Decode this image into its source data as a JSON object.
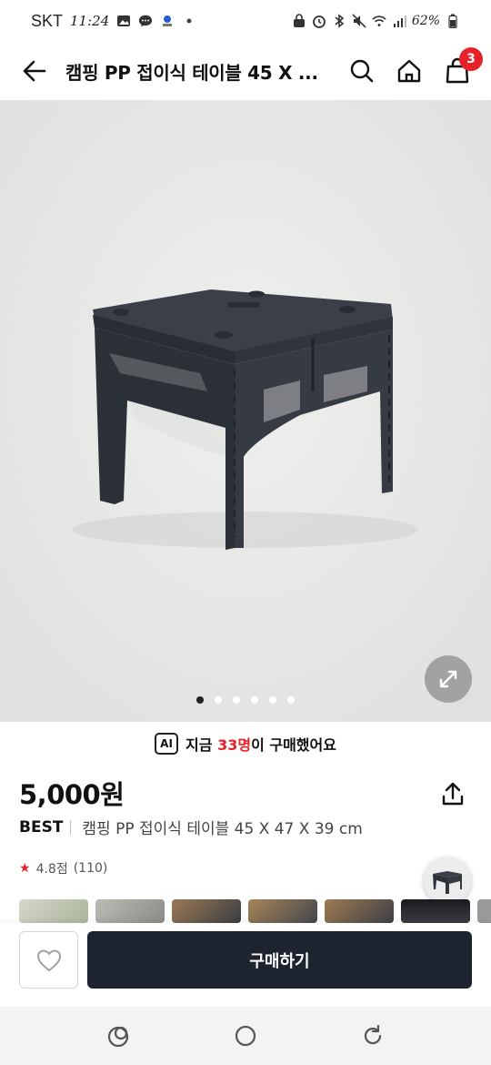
{
  "status_bar": {
    "carrier": "SKT",
    "time": "11:24",
    "battery": "62%"
  },
  "header": {
    "title": "캠핑 PP 접이식 테이블 45 X ...",
    "cart_count": "3"
  },
  "gallery": {
    "image_alt": "folding table photo",
    "dot_count": 6,
    "active_dot": 0
  },
  "recent_purchase": {
    "ai_badge": "AI",
    "prefix": "지금 ",
    "count": "33명",
    "suffix": "이 구매했어요"
  },
  "product": {
    "price": "5,000원",
    "badge": "BEST",
    "name": "캠핑 PP 접이식 테이블 45 X 47 X 39 cm",
    "rating": "4.8점",
    "review_count": "(110)"
  },
  "actions": {
    "buy_label": "구매하기"
  },
  "colors": {
    "accent": "#e5222a",
    "buy_button": "#1d2430",
    "table": "#33373f"
  },
  "icons": {
    "back": "arrow-left-icon",
    "search": "search-icon",
    "home": "home-icon",
    "cart": "shopping-bag-icon",
    "zoom": "expand-icon",
    "share": "share-icon",
    "like": "heart-icon"
  }
}
